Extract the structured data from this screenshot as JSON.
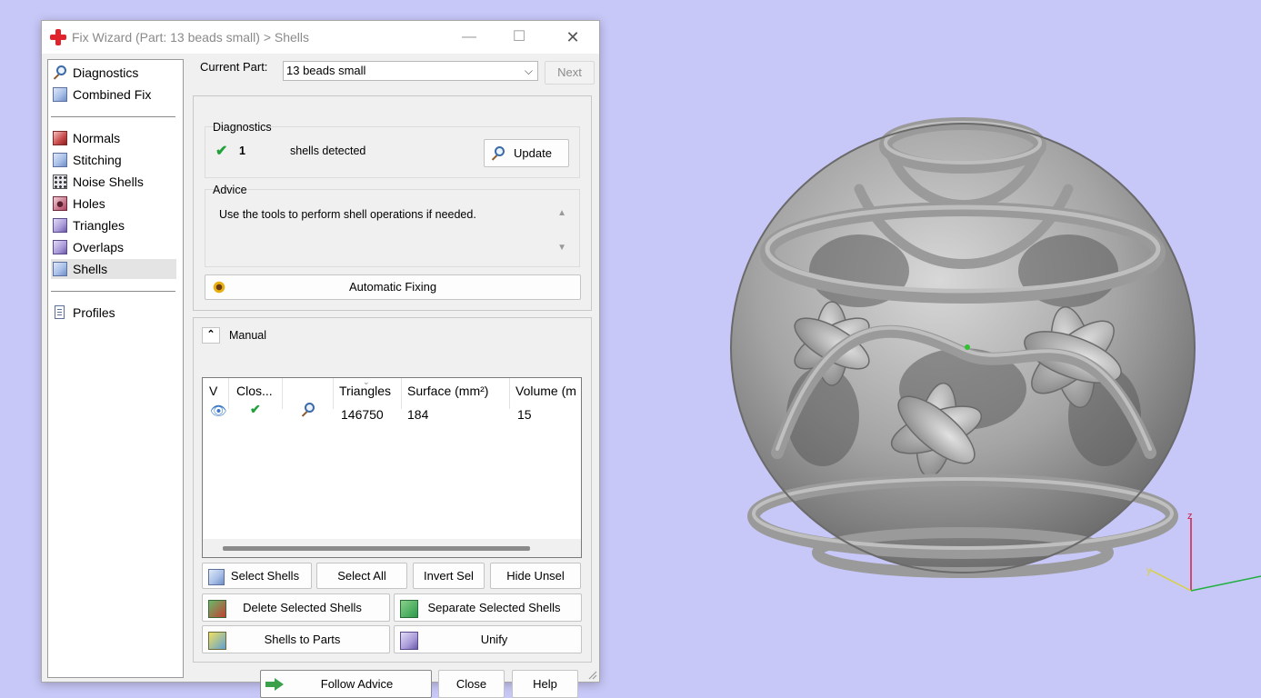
{
  "window": {
    "title": "Fix Wizard (Part: 13 beads small) > Shells",
    "controls": {
      "minimize": "—",
      "maximize": "☐",
      "close": "✕"
    }
  },
  "nav": {
    "items": [
      {
        "label": "Diagnostics",
        "icon": "magnifier-icon"
      },
      {
        "label": "Combined Fix",
        "icon": "cube-icon"
      },
      {
        "label": "Normals",
        "icon": "normals-cube-icon"
      },
      {
        "label": "Stitching",
        "icon": "stitching-cube-icon"
      },
      {
        "label": "Noise Shells",
        "icon": "noise-cube-icon"
      },
      {
        "label": "Holes",
        "icon": "holes-cube-icon"
      },
      {
        "label": "Triangles",
        "icon": "triangles-cube-icon"
      },
      {
        "label": "Overlaps",
        "icon": "overlaps-cube-icon"
      },
      {
        "label": "Shells",
        "icon": "shells-cube-icon",
        "selected": true
      },
      {
        "label": "Profiles",
        "icon": "document-icon"
      }
    ]
  },
  "part": {
    "label": "Current Part:",
    "value": "13 beads small",
    "next_label": "Next"
  },
  "diagnostics": {
    "title": "Diagnostics",
    "count": "1",
    "message": "shells detected",
    "update_label": "Update"
  },
  "advice": {
    "title": "Advice",
    "text": "Use the tools to perform shell operations if needed."
  },
  "automatic_fixing_label": "Automatic Fixing",
  "manual": {
    "title": "Manual",
    "columns": [
      "V",
      "Clos...",
      "",
      "Triangles",
      "Surface (mm²)",
      "Volume (m"
    ],
    "rows": [
      {
        "triangles": "146750",
        "surface": "184",
        "volume": "15"
      }
    ],
    "buttons": {
      "select_shells": "Select Shells",
      "select_all": "Select All",
      "invert_sel": "Invert Sel",
      "hide_unsel": "Hide Unsel",
      "delete_selected": "Delete Selected Shells",
      "separate_selected": "Separate Selected Shells",
      "shells_to_parts": "Shells to Parts",
      "unify": "Unify"
    }
  },
  "footer": {
    "follow_advice": "Follow Advice",
    "close": "Close",
    "help": "Help"
  },
  "axes": {
    "x": "",
    "y": "y",
    "z": "z"
  },
  "colors": {
    "viewport_bg": "#c8c8f8",
    "model": "#a8a8a8",
    "axis_x": "#20b040",
    "axis_y": "#d8d040",
    "axis_z": "#d02040"
  }
}
